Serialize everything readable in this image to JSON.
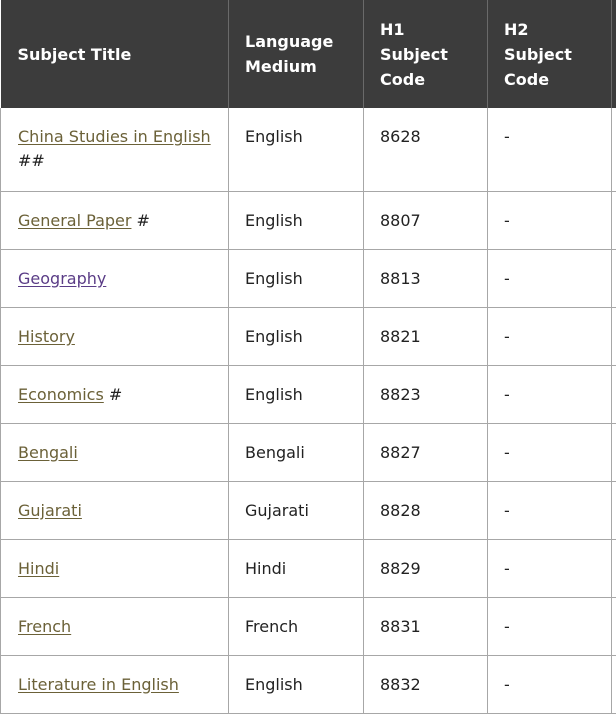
{
  "table": {
    "headers": {
      "subject_title": "Subject Title",
      "language_medium": "Language Medium",
      "h1_code": "H1 Subject Code",
      "h2_code": "H2 Subject Code"
    },
    "rows": [
      {
        "subject": "China Studies in English",
        "mark": "##",
        "language": "English",
        "h1": "8628",
        "h2": "-"
      },
      {
        "subject": "General Paper",
        "mark": "#",
        "language": "English",
        "h1": "8807",
        "h2": "-"
      },
      {
        "subject": "Geography",
        "mark": "",
        "language": "English",
        "h1": "8813",
        "h2": "-"
      },
      {
        "subject": "History",
        "mark": "",
        "language": "English",
        "h1": "8821",
        "h2": "-"
      },
      {
        "subject": "Economics",
        "mark": "#",
        "language": "English",
        "h1": "8823",
        "h2": "-"
      },
      {
        "subject": "Bengali",
        "mark": "",
        "language": "Bengali",
        "h1": "8827",
        "h2": "-"
      },
      {
        "subject": "Gujarati",
        "mark": "",
        "language": "Gujarati",
        "h1": "8828",
        "h2": "-"
      },
      {
        "subject": "Hindi",
        "mark": "",
        "language": "Hindi",
        "h1": "8829",
        "h2": "-"
      },
      {
        "subject": "French",
        "mark": "",
        "language": "French",
        "h1": "8831",
        "h2": "-"
      },
      {
        "subject": "Literature in English",
        "mark": "",
        "language": "English",
        "h1": "8832",
        "h2": "-"
      }
    ]
  },
  "colors": {
    "header_bg": "#3c3c3c",
    "link": "#6b6138",
    "link_visited": "#5a3c86"
  }
}
